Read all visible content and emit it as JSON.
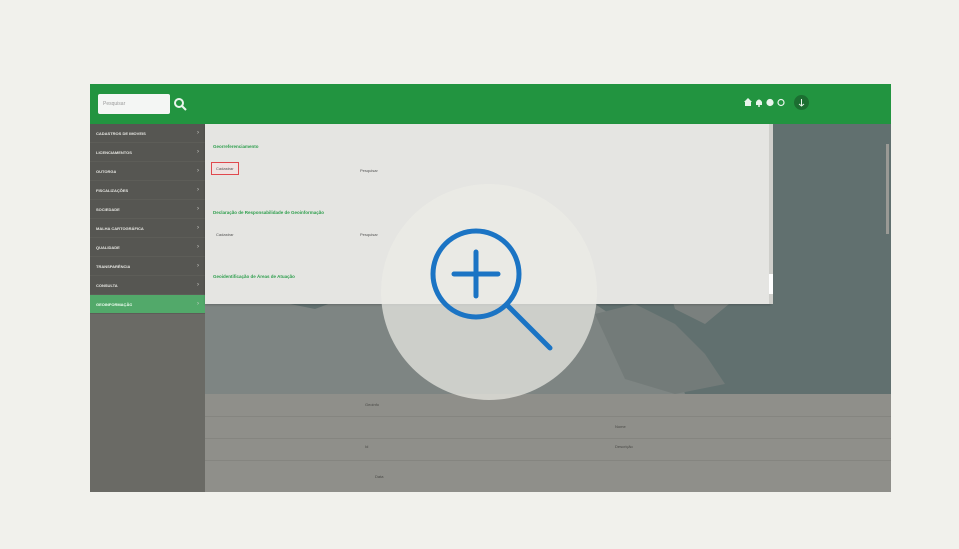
{
  "search": {
    "placeholder": "Pesquisar"
  },
  "sidebar": {
    "items": [
      {
        "label": "CADASTROS DE IMOVEIS"
      },
      {
        "label": "LICENCIAMENTOS"
      },
      {
        "label": "OUTORGA"
      },
      {
        "label": "FISCALIZAÇÕES"
      },
      {
        "label": "SOCIEDADE"
      },
      {
        "label": "MALHA CARTOGRÁFICA"
      },
      {
        "label": "QUALIDADE"
      },
      {
        "label": "TRANSPARÊNCIA"
      },
      {
        "label": "CONSULTA"
      },
      {
        "label": "GEOINFORMAÇÃO"
      }
    ]
  },
  "panel": {
    "section1": {
      "title": "Georreferenciamento",
      "option_left": "Cadastrar",
      "option_right": "Pesquisar"
    },
    "section2": {
      "title": "Declaração de Responsabilidade de Geoinformação",
      "option_left": "Cadastrar",
      "option_right": "Pesquisar"
    },
    "section3": {
      "title": "Geoidentificação de Áreas de Atuação"
    }
  },
  "bottom": {
    "row1_left": "Geoinfo",
    "row1_right": "Nome",
    "row2_left": "Id",
    "row2_right": "Descrição",
    "row3_left": "Data"
  },
  "colors": {
    "brand": "#229440",
    "highlight": "#e0484d",
    "zoom": "#1b74c4"
  }
}
